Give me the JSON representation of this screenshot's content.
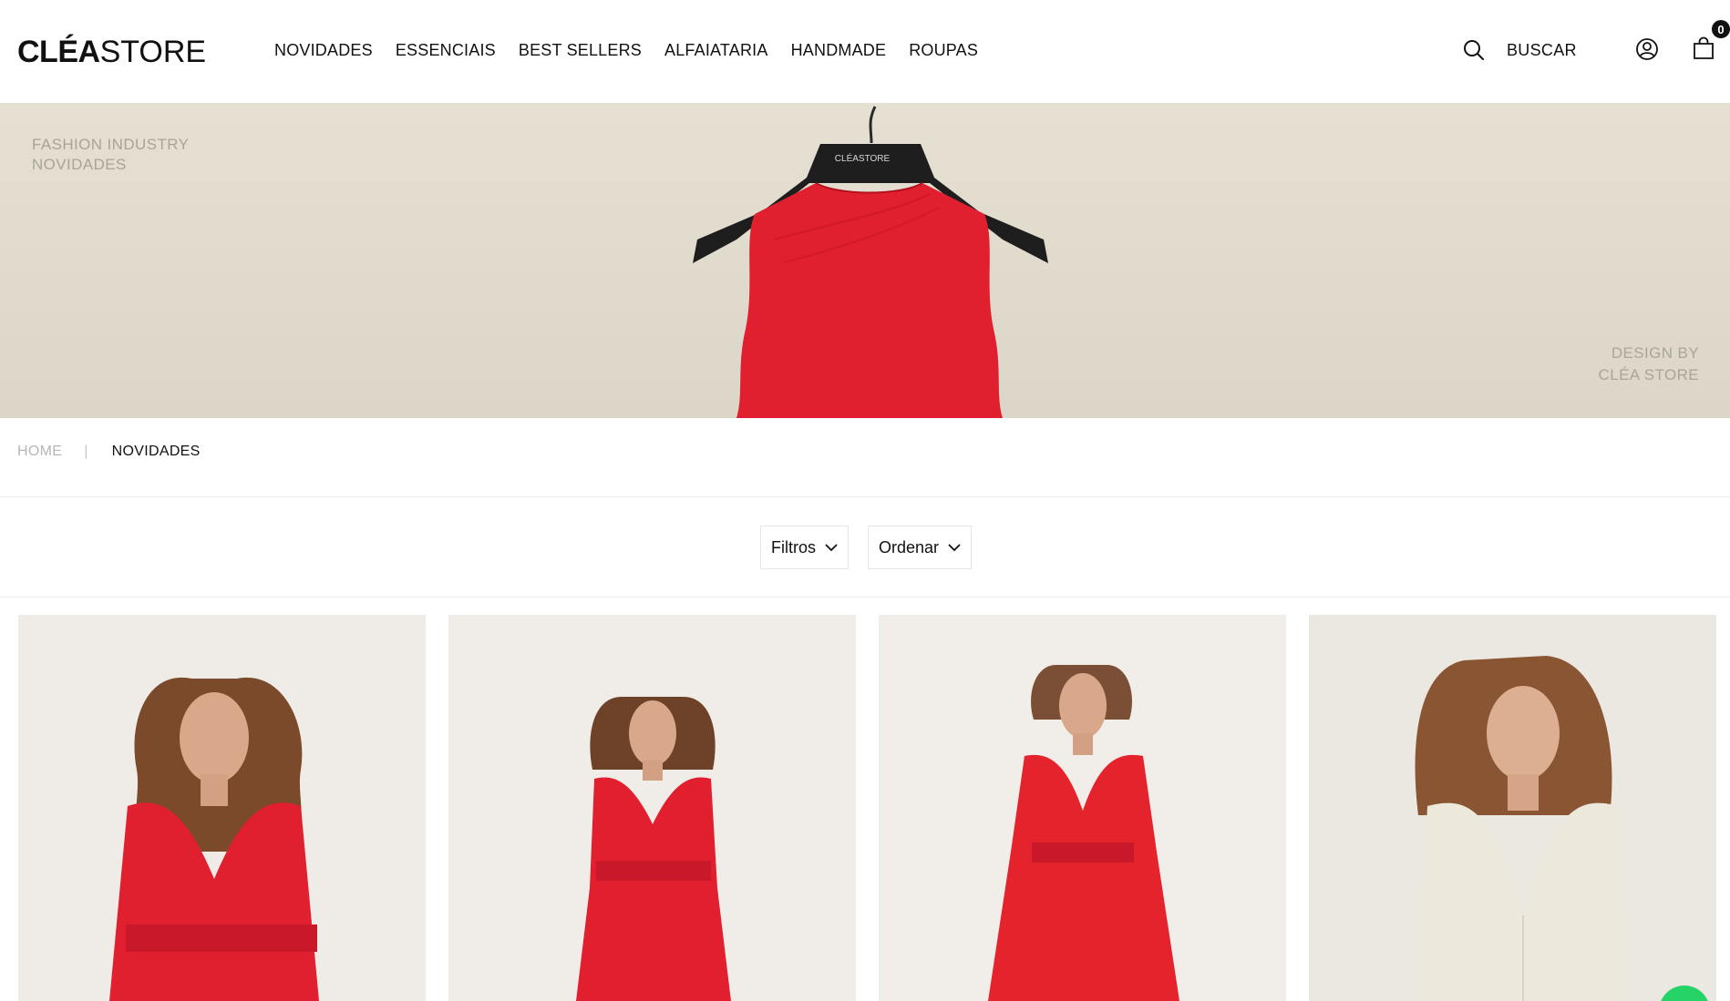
{
  "header": {
    "logo": {
      "part1": "CLÉA",
      "part2": "STORE"
    },
    "nav": [
      "NOVIDADES",
      "ESSENCIAIS",
      "BEST SELLERS",
      "ALFAIATARIA",
      "HANDMADE",
      "ROUPAS"
    ],
    "search_label": "BUSCAR",
    "cart_count": "0"
  },
  "hero": {
    "top_left": [
      "FASHION INDUSTRY",
      "NOVIDADES"
    ],
    "bottom_right": [
      "DESIGN BY",
      "CLÉA STORE"
    ],
    "hanger_label": "CLÉASTORE"
  },
  "breadcrumb": {
    "home": "HOME",
    "separator": "|",
    "current": "NOVIDADES"
  },
  "filters": {
    "filter_label": "Filtros",
    "sort_label": "Ordenar"
  },
  "products": [
    {
      "color": "#e0202f",
      "bg": "#efebe6"
    },
    {
      "color": "#e11f2e",
      "bg": "#f0ece7"
    },
    {
      "color": "#e4232d",
      "bg": "#f1ede8"
    },
    {
      "color": "#ece8dc",
      "bg": "#ebe7e1"
    }
  ],
  "colors": {
    "accent_red": "#e0202f",
    "whatsapp": "#25d366"
  }
}
